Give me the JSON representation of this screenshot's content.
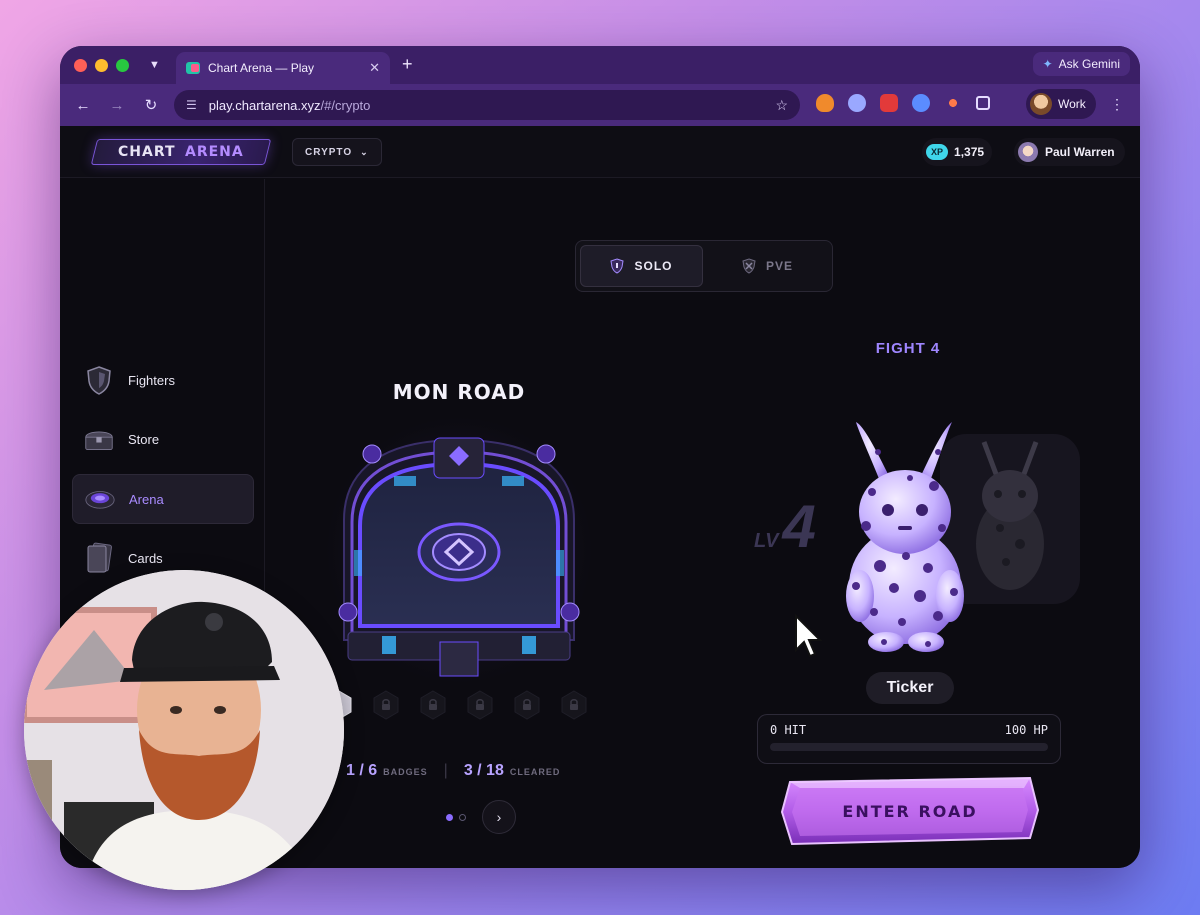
{
  "browser": {
    "tab_title": "Chart Arena — Play",
    "new_tab_glyph": "+",
    "gemini_label": "Ask Gemini",
    "url_host": "play.chartarena.xyz",
    "url_path": "/#/crypto",
    "profile_label": "Work"
  },
  "app": {
    "logo_left": "CHART",
    "logo_right": "ARENA",
    "market_selector": "CRYPTO",
    "xp_badge": "XP",
    "xp_value": "1,375",
    "user_name": "Paul Warren"
  },
  "sidebar": {
    "items": [
      {
        "label": "Fighters",
        "icon": "shield-icon"
      },
      {
        "label": "Store",
        "icon": "chest-icon"
      },
      {
        "label": "Arena",
        "icon": "arena-icon",
        "active": true
      },
      {
        "label": "Cards",
        "icon": "cards-icon"
      }
    ]
  },
  "mode_toggle": {
    "solo": "SOLO",
    "pve": "PVE",
    "active": "SOLO"
  },
  "road": {
    "title": "MON ROAD",
    "badges_value": "1 / 6",
    "badges_label": "BADGES",
    "cleared_value": "3 / 18",
    "cleared_label": "CLEARED",
    "badges_unlocked": 1,
    "badges_total": 6
  },
  "fight": {
    "label": "FIGHT 4",
    "level_prefix": "LV",
    "level_number": "4",
    "opponent_name": "Ticker",
    "hit_text": "0 HIT",
    "hp_text": "100 HP",
    "hit_fraction": 0,
    "enter_button": "ENTER ROAD"
  },
  "colors": {
    "accent": "#8b6cff",
    "button": "#b25de8",
    "frame": "#3b1f66"
  }
}
